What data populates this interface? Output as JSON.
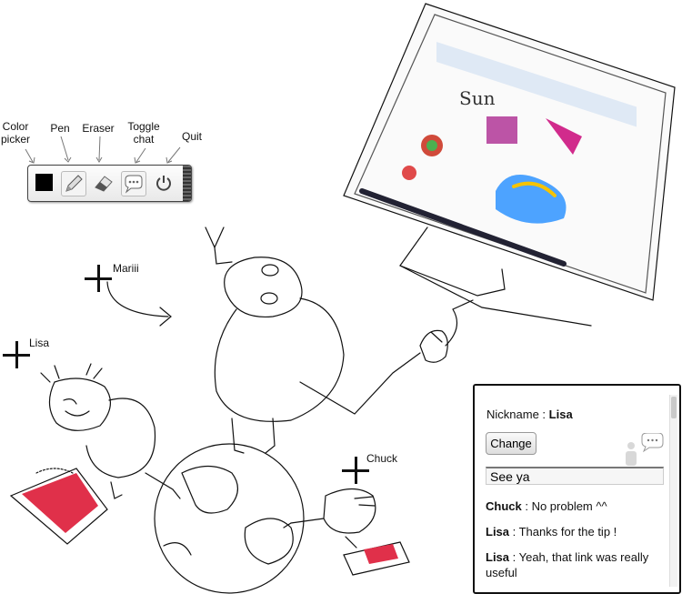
{
  "toolbar": {
    "labels": {
      "color_picker": "Color\npicker",
      "pen": "Pen",
      "eraser": "Eraser",
      "toggle_chat": "Toggle\nchat",
      "quit": "Quit"
    },
    "current_color": "#000000",
    "icons": [
      "color-swatch-icon",
      "pencil-icon",
      "eraser-icon",
      "chat-bubble-icon",
      "power-icon"
    ]
  },
  "cursors": [
    {
      "name": "Mariii"
    },
    {
      "name": "Lisa"
    },
    {
      "name": "Chuck"
    }
  ],
  "chat": {
    "nickname_label": "Nickname :",
    "nickname": "Lisa",
    "change_button": "Change",
    "input_value": "See ya",
    "messages": [
      {
        "author": "Chuck",
        "text": " : No problem ^^"
      },
      {
        "author": "Lisa",
        "text": " : Thanks for the tip !"
      },
      {
        "author": "Lisa",
        "text": " : Yeah, that link was really useful"
      }
    ]
  }
}
